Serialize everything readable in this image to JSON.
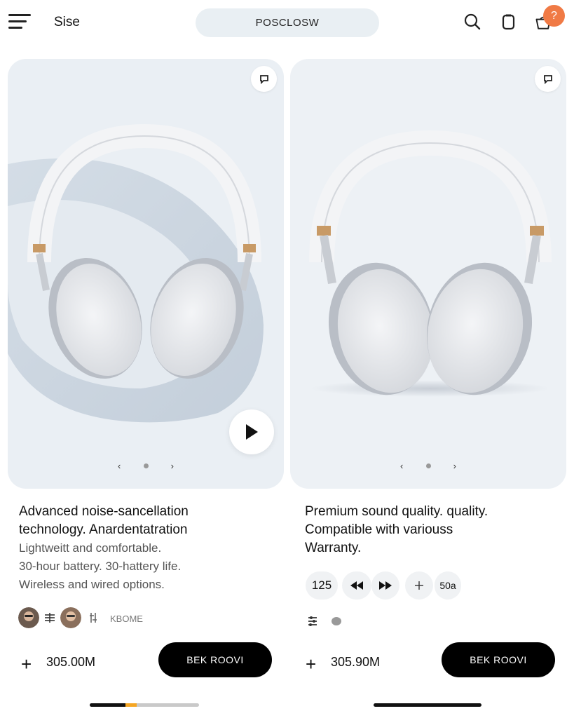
{
  "header": {
    "brand": "Sise",
    "search_label": "POSCLOSW",
    "cart_badge": "?"
  },
  "colors": {
    "accent": "#f07a45",
    "card_bg": "#edf1f5",
    "buy_button": "#000000",
    "progress": "#f5a623"
  },
  "cards": [
    {
      "description": [
        "Advanced noise-sancellation",
        "technology. Anardentatration"
      ],
      "details": [
        "Lightweitt and comfortable.",
        "30-hour battery. 30-hattery life.",
        "Wireless and wired options."
      ],
      "reviewers_label": "KBOME",
      "price": "305.00M",
      "buy_label": "BEK ROOVI",
      "icons": [
        "pin-icon",
        "play-icon"
      ]
    },
    {
      "description": [
        "Premium sound quality. quality.",
        "Compatible with variouss",
        "Warranty."
      ],
      "controls": [
        "125",
        "50a"
      ],
      "price": "305.90M",
      "buy_label": "BEK ROOVI",
      "icons": [
        "pin-icon",
        "rewind-icon",
        "fast-forward-icon",
        "plus-icon"
      ]
    }
  ],
  "progress": {
    "value": 0.38
  }
}
